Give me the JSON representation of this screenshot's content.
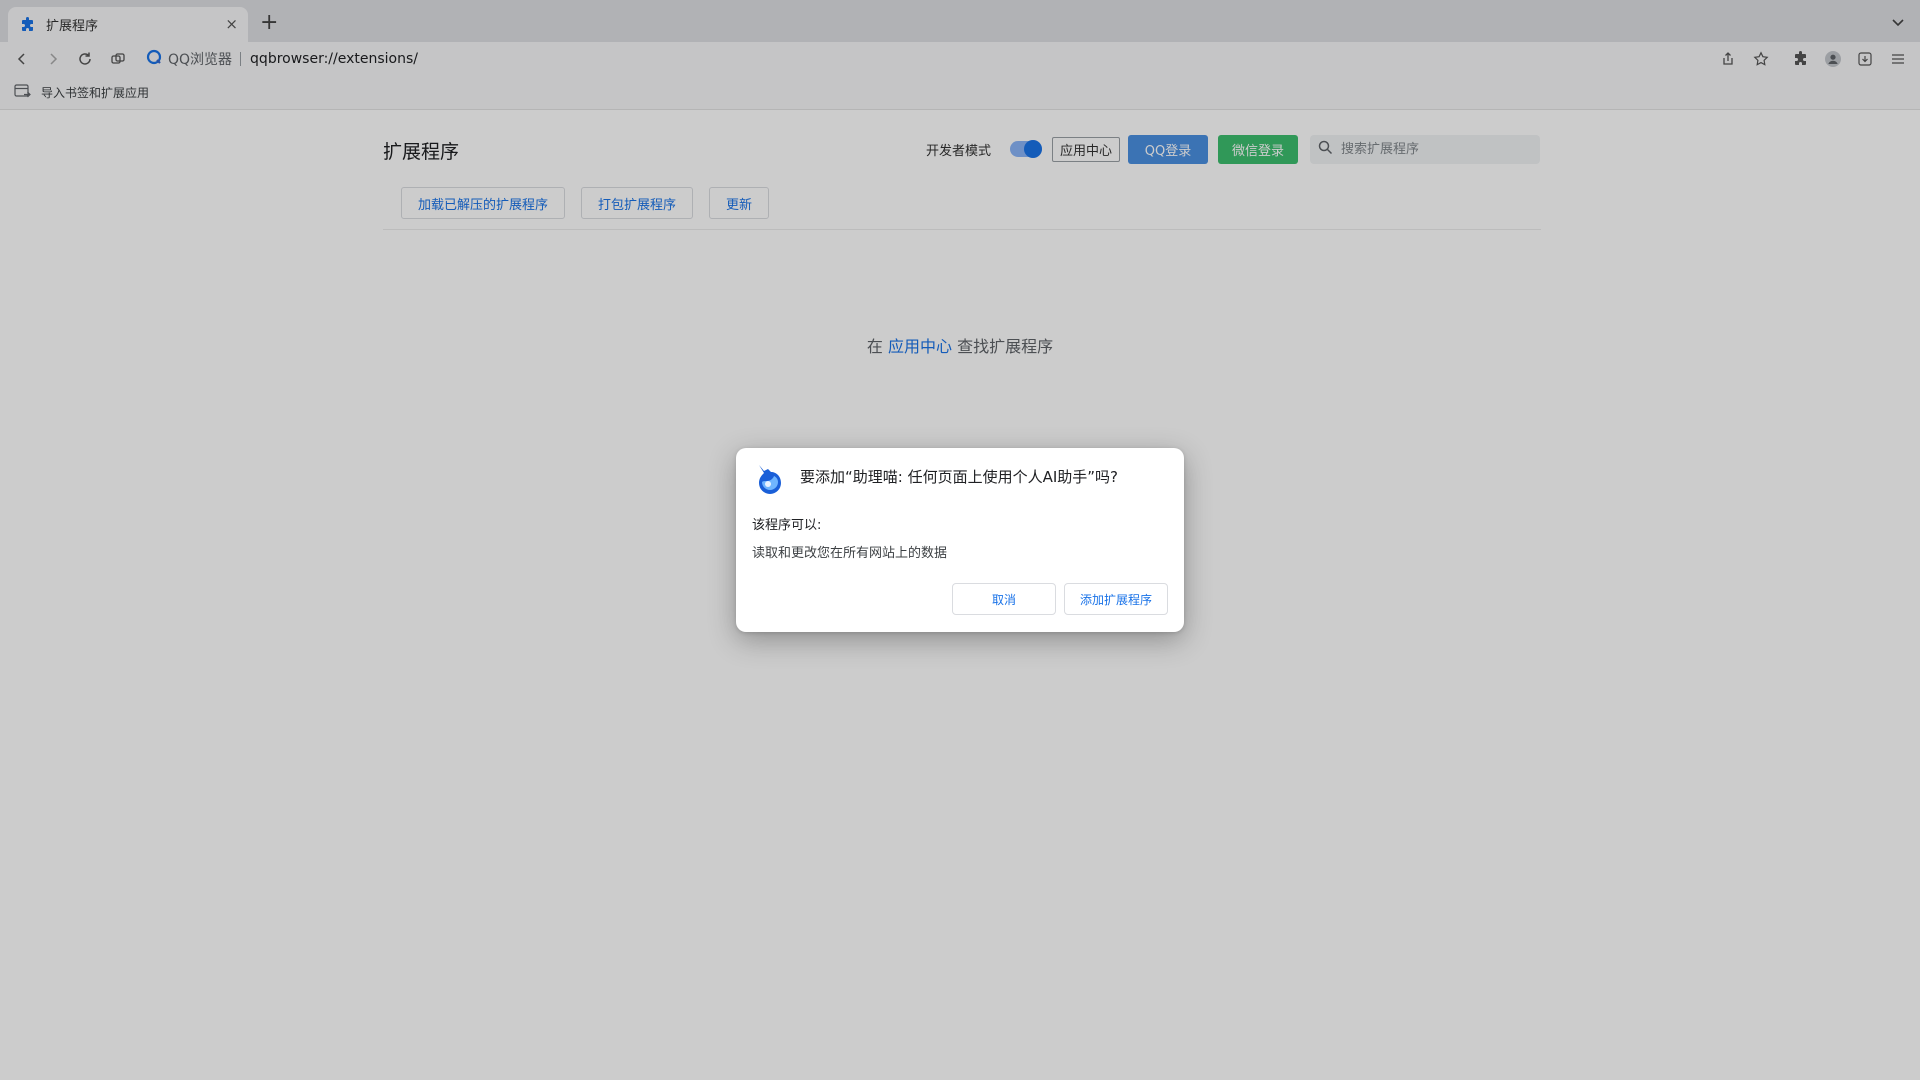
{
  "tab": {
    "title": "扩展程序",
    "icon": "puzzle-icon",
    "close_glyph": "×",
    "new_tab_glyph": "+"
  },
  "toolbar": {
    "brand_name": "QQ浏览器",
    "url": "qqbrowser://extensions/"
  },
  "bookmarks_bar": {
    "import_label": "导入书签和扩展应用"
  },
  "page": {
    "title": "扩展程序",
    "developer_mode_label": "开发者模式",
    "developer_mode_on": true,
    "app_center_button": "应用中心",
    "qq_login_button": "QQ登录",
    "wechat_login_button": "微信登录",
    "search_placeholder": "搜索扩展程序",
    "actions": {
      "load_unpacked": "加载已解压的扩展程序",
      "pack_extension": "打包扩展程序",
      "update": "更新"
    },
    "empty_hint": {
      "prefix": "在 ",
      "link": "应用中心",
      "suffix": " 查找扩展程序"
    }
  },
  "dialog": {
    "title": "要添加“助理喵: 任何页面上使用个人AI助手”吗?",
    "permissions_label": "该程序可以:",
    "permissions": [
      "读取和更改您在所有网站上的数据"
    ],
    "cancel_button": "取消",
    "add_button": "添加扩展程序"
  },
  "colors": {
    "accent": "#1a73e8",
    "qq_login": "#4a90e2",
    "wechat_login": "#3cbf6e"
  }
}
